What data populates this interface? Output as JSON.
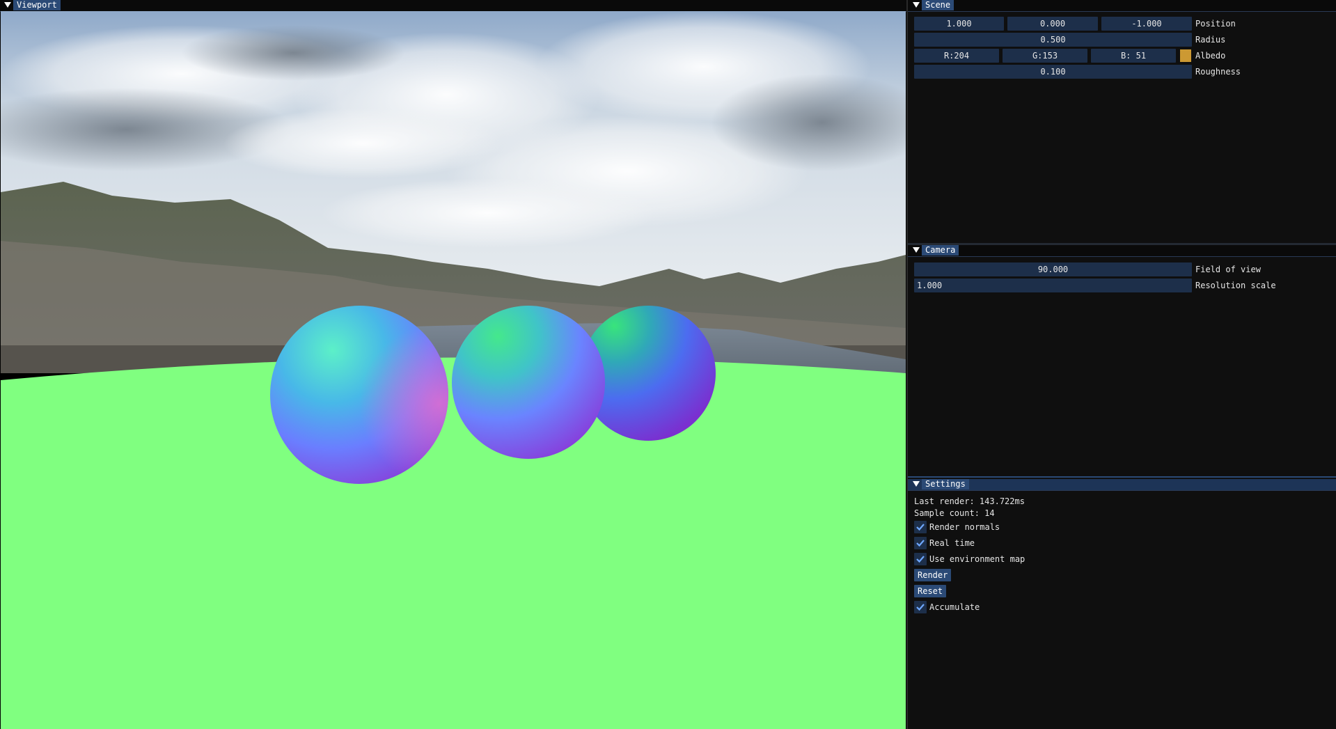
{
  "viewport": {
    "tab_label": "Viewport"
  },
  "scene": {
    "tab_label": "Scene",
    "position": {
      "x": "1.000",
      "y": "0.000",
      "z": "-1.000",
      "label": "Position"
    },
    "radius": {
      "value": "0.500",
      "label": "Radius"
    },
    "albedo": {
      "r": "R:204",
      "g": "G:153",
      "b": "B: 51",
      "label": "Albedo",
      "color": "#cc9933"
    },
    "roughness": {
      "value": "0.100",
      "label": "Roughness"
    }
  },
  "camera": {
    "tab_label": "Camera",
    "fov": {
      "value": "90.000",
      "label": "Field of view"
    },
    "resolution_scale": {
      "value": "1.000",
      "label": "Resolution scale"
    }
  },
  "settings": {
    "tab_label": "Settings",
    "last_render": "Last render: 143.722ms",
    "sample_count": "Sample count: 14",
    "render_normals": {
      "label": "Render normals",
      "checked": true
    },
    "real_time": {
      "label": "Real time",
      "checked": true
    },
    "use_env_map": {
      "label": "Use environment map",
      "checked": true
    },
    "render_button": "Render",
    "reset_button": "Reset",
    "accumulate": {
      "label": "Accumulate",
      "checked": true
    }
  },
  "colors": {
    "accent": "#2b4a76",
    "field_bg": "#1d2f4a",
    "ground": "#80ff80"
  }
}
